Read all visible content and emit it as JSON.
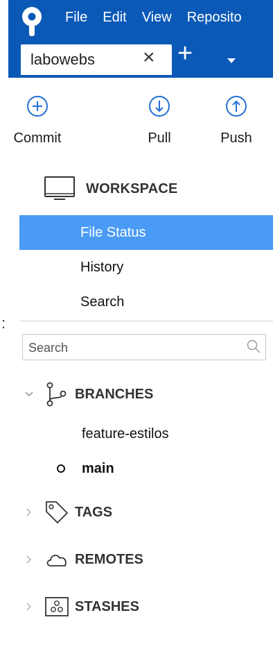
{
  "menu": {
    "items": [
      {
        "label": "File"
      },
      {
        "label": "Edit"
      },
      {
        "label": "View"
      },
      {
        "label": "Reposito"
      }
    ]
  },
  "tab": {
    "label": "labowebs",
    "close_glyph": "×",
    "add_glyph": "+"
  },
  "toolbar": {
    "commit_label": "Commit",
    "pull_label": "Pull",
    "push_label": "Push"
  },
  "workspace": {
    "title": "WORKSPACE",
    "items": [
      {
        "label": "File Status",
        "selected": true
      },
      {
        "label": "History"
      },
      {
        "label": "Search"
      }
    ]
  },
  "search": {
    "placeholder": "Search"
  },
  "branches": {
    "title": "BRANCHES",
    "items": [
      {
        "label": "feature-estilos"
      },
      {
        "label": "main",
        "current": true
      }
    ]
  },
  "tags": {
    "title": "TAGS"
  },
  "remotes": {
    "title": "REMOTES"
  },
  "stashes": {
    "title": "STASHES"
  },
  "colors": {
    "titlebar": "#0b59b7",
    "selection": "#4a9bf5",
    "toolbar_icon": "#1f6fd6"
  },
  "icons": {
    "app": "sourcetree-logo-icon",
    "commit": "plus-circle-icon",
    "pull": "arrow-down-circle-icon",
    "push": "arrow-up-circle-icon",
    "workspace": "monitor-icon",
    "branches": "branch-icon",
    "tags": "tag-icon",
    "remotes": "cloud-icon",
    "stashes": "stash-box-icon",
    "search": "search-icon"
  }
}
